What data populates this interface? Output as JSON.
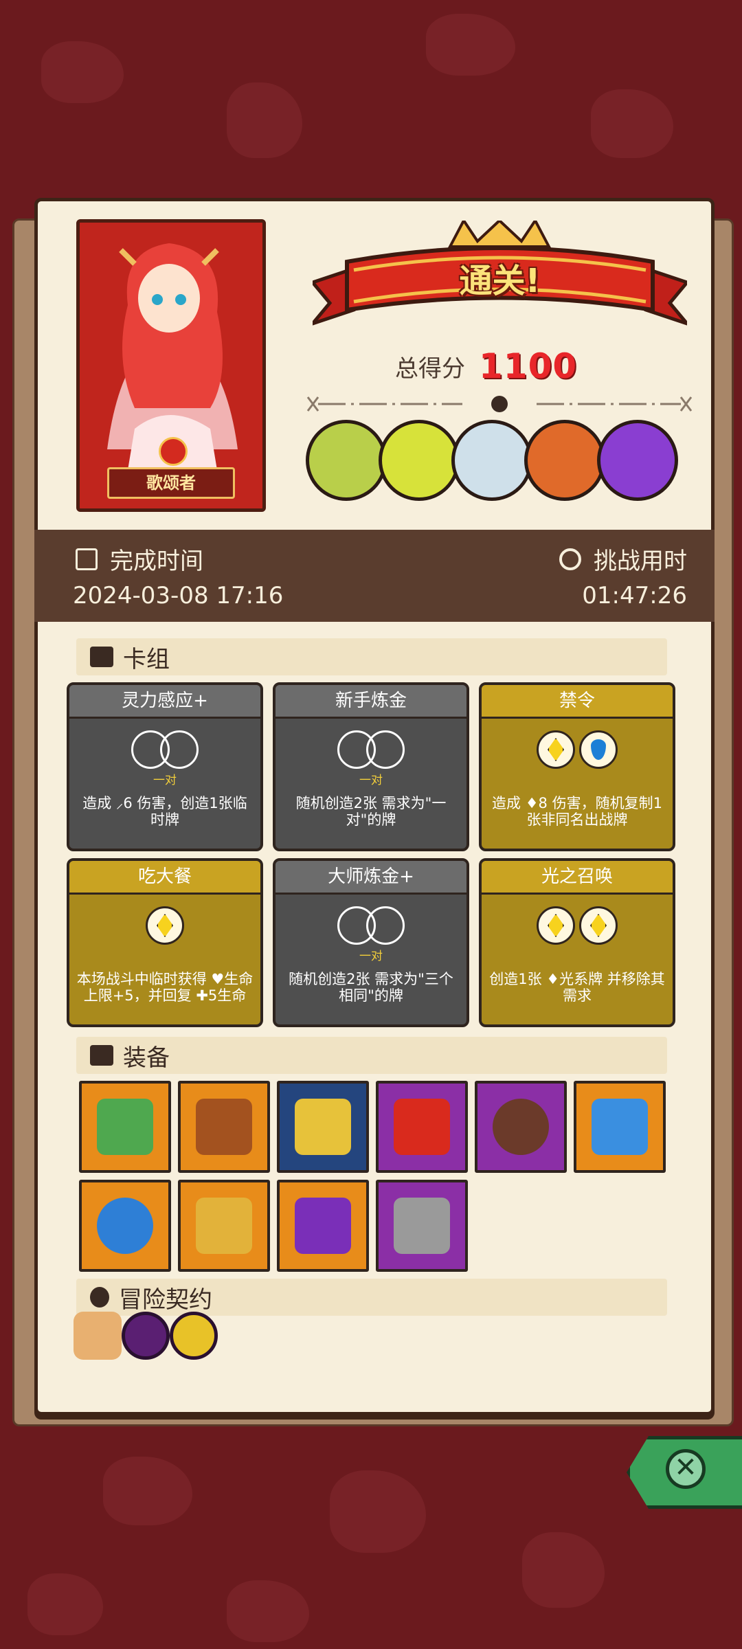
{
  "hero": {
    "name": "歌颂者"
  },
  "result": {
    "banner": "通关!",
    "score_label": "总得分",
    "score_value": "1100"
  },
  "bosses": [
    "green-skull-boss",
    "red-horned-demon-boss",
    "spotted-beast-boss",
    "red-masked-warrior-boss",
    "purple-shadow-boss"
  ],
  "info": {
    "finish_time_label": "完成时间",
    "finish_time_value": "2024-03-08 17:16",
    "challenge_time_label": "挑战用时",
    "challenge_time_value": "01:47:26"
  },
  "deck": {
    "title": "卡组",
    "cards": [
      {
        "title": "灵力感应+",
        "pair": "一对",
        "desc": "造成 ⸝6 伤害，创造1张临时牌"
      },
      {
        "title": "新手炼金",
        "pair": "一对",
        "desc": "随机创造2张 需求为\"一对\"的牌"
      },
      {
        "title": "禁令",
        "pair": "",
        "desc": "造成 ♦8 伤害，随机复制1张非同名出战牌"
      },
      {
        "title": "吃大餐",
        "pair": "",
        "desc": "本场战斗中临时获得 ♥生命上限+5，并回复 ✚5生命"
      },
      {
        "title": "大师炼金+",
        "pair": "一对",
        "desc": "随机创造2张 需求为\"三个相同\"的牌"
      },
      {
        "title": "光之召唤",
        "pair": "",
        "desc": "创造1张 ♦光系牌 并移除其需求"
      }
    ]
  },
  "equipment": {
    "title": "装备",
    "items": [
      "green-tablet-icon",
      "flame-wood-icon",
      "gold-helmet-icon",
      "red-gauntlet-icon",
      "brown-button-icon",
      "blue-slime-icon",
      "blue-spiked-orb-icon",
      "lion-ring-icon",
      "purple-hood-icon",
      "stone-cube-icon"
    ]
  },
  "contract": {
    "title": "冒险契约",
    "items": [
      "scroll-icon",
      "purple-eye-coin-icon",
      "gold-coin-icon"
    ]
  },
  "colors": {
    "background": "#6b1a1e",
    "panel": "#f7efdc",
    "score": "#e8262a",
    "gold_card": "#a98a1c",
    "gray_card": "#4f4f4f"
  }
}
